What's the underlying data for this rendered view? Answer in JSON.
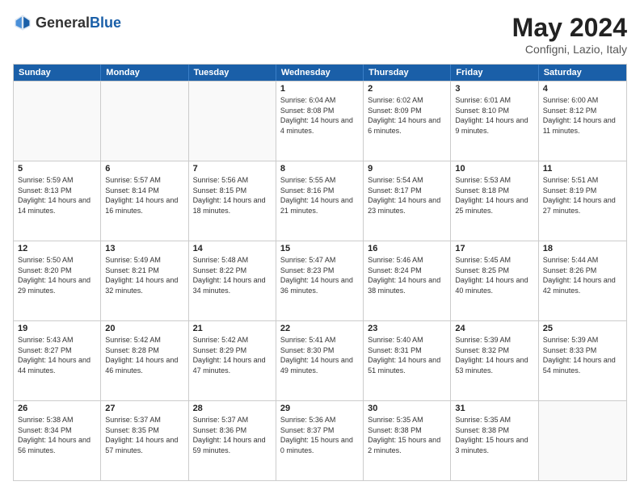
{
  "logo": {
    "general": "General",
    "blue": "Blue"
  },
  "title": "May 2024",
  "location": "Configni, Lazio, Italy",
  "days": [
    "Sunday",
    "Monday",
    "Tuesday",
    "Wednesday",
    "Thursday",
    "Friday",
    "Saturday"
  ],
  "weeks": [
    [
      {
        "day": "",
        "sunrise": "",
        "sunset": "",
        "daylight": ""
      },
      {
        "day": "",
        "sunrise": "",
        "sunset": "",
        "daylight": ""
      },
      {
        "day": "",
        "sunrise": "",
        "sunset": "",
        "daylight": ""
      },
      {
        "day": "1",
        "sunrise": "Sunrise: 6:04 AM",
        "sunset": "Sunset: 8:08 PM",
        "daylight": "Daylight: 14 hours and 4 minutes."
      },
      {
        "day": "2",
        "sunrise": "Sunrise: 6:02 AM",
        "sunset": "Sunset: 8:09 PM",
        "daylight": "Daylight: 14 hours and 6 minutes."
      },
      {
        "day": "3",
        "sunrise": "Sunrise: 6:01 AM",
        "sunset": "Sunset: 8:10 PM",
        "daylight": "Daylight: 14 hours and 9 minutes."
      },
      {
        "day": "4",
        "sunrise": "Sunrise: 6:00 AM",
        "sunset": "Sunset: 8:12 PM",
        "daylight": "Daylight: 14 hours and 11 minutes."
      }
    ],
    [
      {
        "day": "5",
        "sunrise": "Sunrise: 5:59 AM",
        "sunset": "Sunset: 8:13 PM",
        "daylight": "Daylight: 14 hours and 14 minutes."
      },
      {
        "day": "6",
        "sunrise": "Sunrise: 5:57 AM",
        "sunset": "Sunset: 8:14 PM",
        "daylight": "Daylight: 14 hours and 16 minutes."
      },
      {
        "day": "7",
        "sunrise": "Sunrise: 5:56 AM",
        "sunset": "Sunset: 8:15 PM",
        "daylight": "Daylight: 14 hours and 18 minutes."
      },
      {
        "day": "8",
        "sunrise": "Sunrise: 5:55 AM",
        "sunset": "Sunset: 8:16 PM",
        "daylight": "Daylight: 14 hours and 21 minutes."
      },
      {
        "day": "9",
        "sunrise": "Sunrise: 5:54 AM",
        "sunset": "Sunset: 8:17 PM",
        "daylight": "Daylight: 14 hours and 23 minutes."
      },
      {
        "day": "10",
        "sunrise": "Sunrise: 5:53 AM",
        "sunset": "Sunset: 8:18 PM",
        "daylight": "Daylight: 14 hours and 25 minutes."
      },
      {
        "day": "11",
        "sunrise": "Sunrise: 5:51 AM",
        "sunset": "Sunset: 8:19 PM",
        "daylight": "Daylight: 14 hours and 27 minutes."
      }
    ],
    [
      {
        "day": "12",
        "sunrise": "Sunrise: 5:50 AM",
        "sunset": "Sunset: 8:20 PM",
        "daylight": "Daylight: 14 hours and 29 minutes."
      },
      {
        "day": "13",
        "sunrise": "Sunrise: 5:49 AM",
        "sunset": "Sunset: 8:21 PM",
        "daylight": "Daylight: 14 hours and 32 minutes."
      },
      {
        "day": "14",
        "sunrise": "Sunrise: 5:48 AM",
        "sunset": "Sunset: 8:22 PM",
        "daylight": "Daylight: 14 hours and 34 minutes."
      },
      {
        "day": "15",
        "sunrise": "Sunrise: 5:47 AM",
        "sunset": "Sunset: 8:23 PM",
        "daylight": "Daylight: 14 hours and 36 minutes."
      },
      {
        "day": "16",
        "sunrise": "Sunrise: 5:46 AM",
        "sunset": "Sunset: 8:24 PM",
        "daylight": "Daylight: 14 hours and 38 minutes."
      },
      {
        "day": "17",
        "sunrise": "Sunrise: 5:45 AM",
        "sunset": "Sunset: 8:25 PM",
        "daylight": "Daylight: 14 hours and 40 minutes."
      },
      {
        "day": "18",
        "sunrise": "Sunrise: 5:44 AM",
        "sunset": "Sunset: 8:26 PM",
        "daylight": "Daylight: 14 hours and 42 minutes."
      }
    ],
    [
      {
        "day": "19",
        "sunrise": "Sunrise: 5:43 AM",
        "sunset": "Sunset: 8:27 PM",
        "daylight": "Daylight: 14 hours and 44 minutes."
      },
      {
        "day": "20",
        "sunrise": "Sunrise: 5:42 AM",
        "sunset": "Sunset: 8:28 PM",
        "daylight": "Daylight: 14 hours and 46 minutes."
      },
      {
        "day": "21",
        "sunrise": "Sunrise: 5:42 AM",
        "sunset": "Sunset: 8:29 PM",
        "daylight": "Daylight: 14 hours and 47 minutes."
      },
      {
        "day": "22",
        "sunrise": "Sunrise: 5:41 AM",
        "sunset": "Sunset: 8:30 PM",
        "daylight": "Daylight: 14 hours and 49 minutes."
      },
      {
        "day": "23",
        "sunrise": "Sunrise: 5:40 AM",
        "sunset": "Sunset: 8:31 PM",
        "daylight": "Daylight: 14 hours and 51 minutes."
      },
      {
        "day": "24",
        "sunrise": "Sunrise: 5:39 AM",
        "sunset": "Sunset: 8:32 PM",
        "daylight": "Daylight: 14 hours and 53 minutes."
      },
      {
        "day": "25",
        "sunrise": "Sunrise: 5:39 AM",
        "sunset": "Sunset: 8:33 PM",
        "daylight": "Daylight: 14 hours and 54 minutes."
      }
    ],
    [
      {
        "day": "26",
        "sunrise": "Sunrise: 5:38 AM",
        "sunset": "Sunset: 8:34 PM",
        "daylight": "Daylight: 14 hours and 56 minutes."
      },
      {
        "day": "27",
        "sunrise": "Sunrise: 5:37 AM",
        "sunset": "Sunset: 8:35 PM",
        "daylight": "Daylight: 14 hours and 57 minutes."
      },
      {
        "day": "28",
        "sunrise": "Sunrise: 5:37 AM",
        "sunset": "Sunset: 8:36 PM",
        "daylight": "Daylight: 14 hours and 59 minutes."
      },
      {
        "day": "29",
        "sunrise": "Sunrise: 5:36 AM",
        "sunset": "Sunset: 8:37 PM",
        "daylight": "Daylight: 15 hours and 0 minutes."
      },
      {
        "day": "30",
        "sunrise": "Sunrise: 5:35 AM",
        "sunset": "Sunset: 8:38 PM",
        "daylight": "Daylight: 15 hours and 2 minutes."
      },
      {
        "day": "31",
        "sunrise": "Sunrise: 5:35 AM",
        "sunset": "Sunset: 8:38 PM",
        "daylight": "Daylight: 15 hours and 3 minutes."
      },
      {
        "day": "",
        "sunrise": "",
        "sunset": "",
        "daylight": ""
      }
    ]
  ]
}
